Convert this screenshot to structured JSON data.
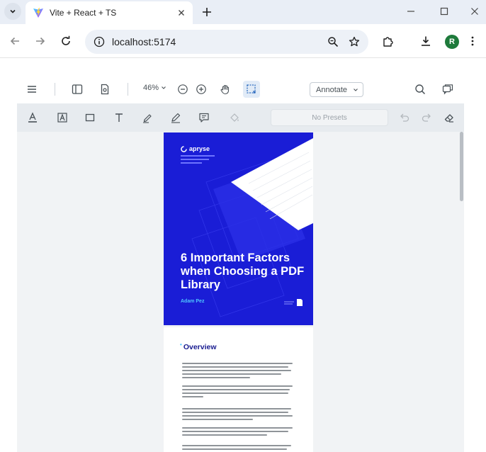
{
  "browser": {
    "tab_title": "Vite + React + TS",
    "url": "localhost:5174",
    "profile_initial": "R"
  },
  "viewer": {
    "zoom_label": "46%",
    "mode_select": "Annotate",
    "presets_label": "No Presets"
  },
  "document": {
    "brand": "apryse",
    "cover_title": "6 Important Factors when Choosing a PDF Library",
    "author": "Adam Pez",
    "section_heading": "Overview"
  },
  "colors": {
    "cover_blue": "#1a1dd6",
    "heading_navy": "#171a8f",
    "accent_cyan": "#4fc6ff"
  }
}
